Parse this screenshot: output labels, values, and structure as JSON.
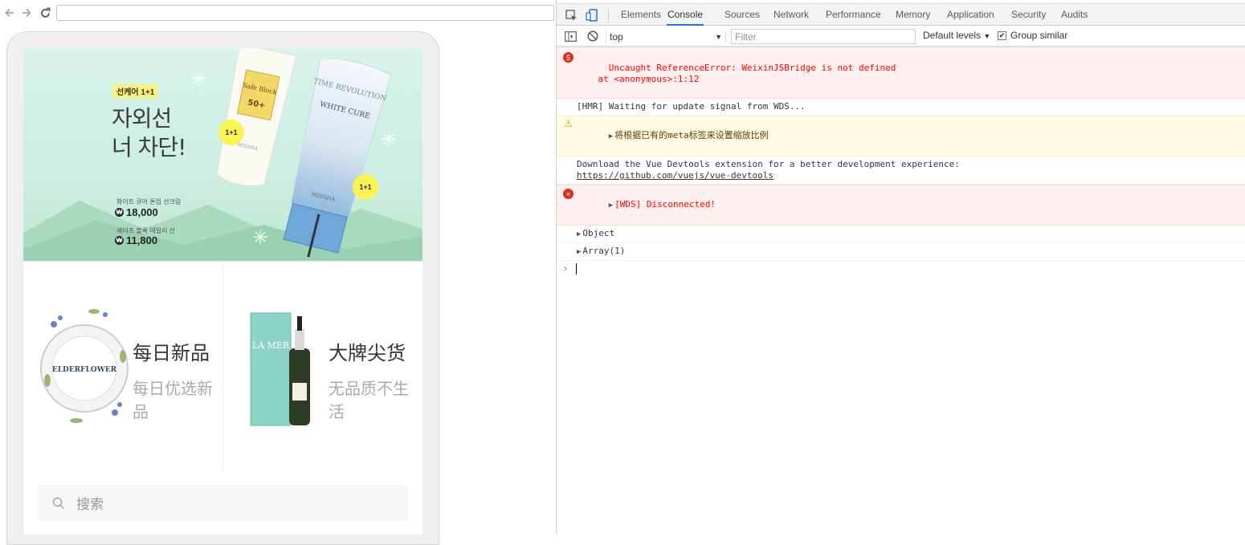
{
  "browser": {
    "address_value": ""
  },
  "banner": {
    "tag": "선케어 1+1",
    "title_line1": "자외선",
    "title_line2": "너 차단!",
    "price1_label": "화이트 큐어 톤업 선크림",
    "price1": "18,000",
    "price2_label": "세이프 블록 데일리 선",
    "price2": "11,800",
    "won_symbol": "₩",
    "badge": "1+1",
    "tube1_brand": "MISSHA",
    "tube2_title": "TIME REVOLUTION",
    "tube2_sub": "WHITE CURE",
    "tube2_brand": "MISSHA",
    "tube1_label": "Safe Block",
    "tube1_spf": "50+"
  },
  "products": [
    {
      "title": "每日新品",
      "subtitle": "每日优选新品",
      "image_label": "ELDERFLOWER"
    },
    {
      "title": "大牌尖货",
      "subtitle": "无品质不生活",
      "image_label": "LA MER"
    }
  ],
  "search": {
    "placeholder": "搜索"
  },
  "devtools": {
    "tabs": [
      "Elements",
      "Console",
      "Sources",
      "Network",
      "Performance",
      "Memory",
      "Application",
      "Security",
      "Audits"
    ],
    "active_tab": "Console",
    "context": "top",
    "filter_placeholder": "Filter",
    "levels": "Default levels",
    "group_similar": "Group similar",
    "group_similar_checked": true
  },
  "console": {
    "error_count": "5",
    "messages": [
      {
        "level": "error",
        "line1": "Uncaught ReferenceError: WeixinJSBridge is not defined",
        "line2": "    at <anonymous>:1:12"
      },
      {
        "level": "log",
        "text": "[HMR] Waiting for update signal from WDS..."
      },
      {
        "level": "warn",
        "text": "将根据已有的meta标签来设置缩放比例"
      },
      {
        "level": "log",
        "line1": "Download the Vue Devtools extension for a better development experience:",
        "link": "https://github.com/vuejs/vue-devtools"
      },
      {
        "level": "error",
        "text": "[WDS] Disconnected!"
      },
      {
        "level": "log",
        "text": "Object"
      },
      {
        "level": "log",
        "text": "Array(1)"
      }
    ]
  },
  "colors": {
    "accent": "#1a73e8",
    "error_text": "#ff0000",
    "error_bg": "#fff0f0",
    "warn_bg": "#fffbe5",
    "banner_bg": "#cdeee2",
    "badge_yellow": "#fbf254"
  }
}
